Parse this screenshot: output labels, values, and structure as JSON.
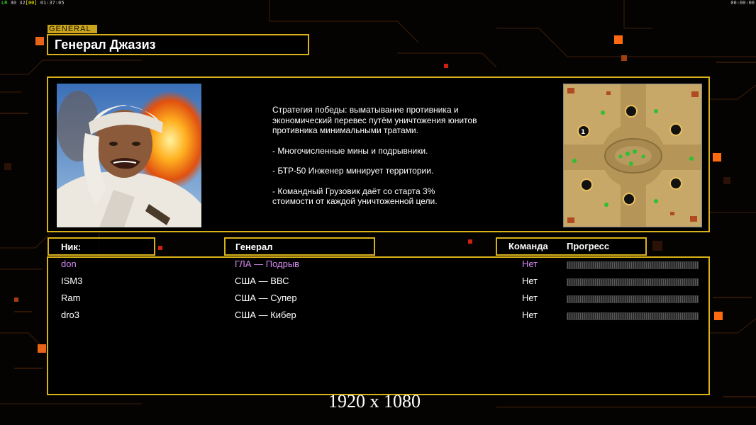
{
  "hud": {
    "top_left_a": "LR",
    "top_left_b": "30 32",
    "top_left_c": "[00]",
    "top_left_time": "01:37:05",
    "top_right_time": "00:00:00"
  },
  "general": {
    "tag": "GENERAL",
    "name": "Генерал Джазиз",
    "description": [
      "Стратегия победы: выматывание противника и\n экономический перевес путём уничтожения юнитов\n противника минимальными тратами.",
      "- Многочисленные мины и подрывники.",
      "- БТР-50 Инженер минирует территории.",
      "- Командный Грузовик даёт со старта 3%\n стоимости от каждой уничтоженной цели."
    ]
  },
  "table": {
    "headers": {
      "nick": "Ник:",
      "general": "Генерал",
      "team": "Команда",
      "progress": "Прогресс"
    },
    "rows": [
      {
        "nick": "don",
        "general": "ГЛА — Подрыв",
        "team": "Нет",
        "progress": 0
      },
      {
        "nick": "ISM3",
        "general": "США — ВВС",
        "team": "Нет",
        "progress": 0
      },
      {
        "nick": "Ram",
        "general": "США — Супер",
        "team": "Нет",
        "progress": 0
      },
      {
        "nick": "dro3",
        "general": "США — Кибер",
        "team": "Нет",
        "progress": 0
      }
    ]
  },
  "overlay": {
    "resolution": "1920 x 1080"
  },
  "colors": {
    "accent": "#d9b21a",
    "highlight_player": "#d48af0",
    "orange_marker": "#ff6a10"
  }
}
